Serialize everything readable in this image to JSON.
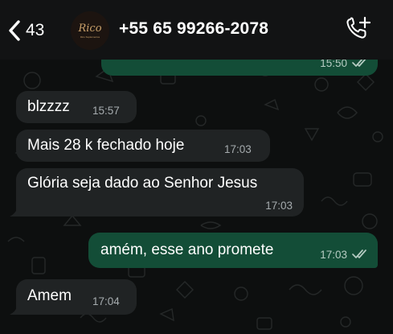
{
  "header": {
    "back_count": "43",
    "avatar_logo": "Rico",
    "avatar_sub": "Rico Suplementos",
    "contact_name": "+55 65 99266-2078"
  },
  "messages": [
    {
      "direction": "outgoing",
      "text": "",
      "time": "15:50",
      "status": "read"
    },
    {
      "direction": "incoming",
      "text": "blzzzz",
      "time": "15:57"
    },
    {
      "direction": "incoming",
      "text": "Mais 28 k fechado hoje",
      "time": "17:03"
    },
    {
      "direction": "incoming",
      "text": "Glória seja dado ao Senhor Jesus",
      "time": "17:03"
    },
    {
      "direction": "outgoing",
      "text": "amém, esse ano promete",
      "time": "17:03",
      "status": "read"
    },
    {
      "direction": "incoming",
      "text": "Amem",
      "time": "17:04"
    }
  ],
  "colors": {
    "incoming_bubble": "#202324",
    "outgoing_bubble": "#134d37",
    "header_bg": "#121314",
    "read_ticks": "#b6ccc3"
  },
  "icons": {
    "back": "chevron-left-icon",
    "call": "phone-add-icon",
    "ticks": "double-check-icon"
  }
}
